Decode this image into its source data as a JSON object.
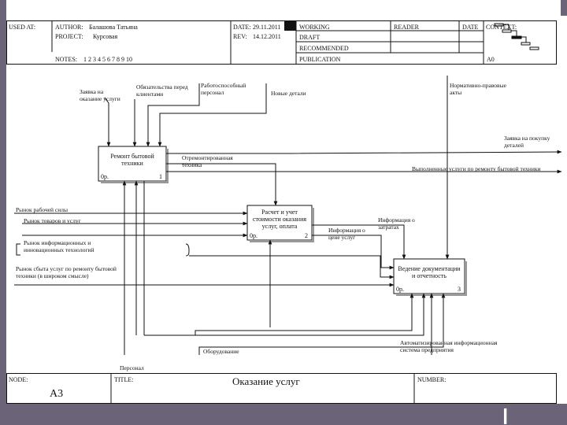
{
  "header": {
    "used_at_label": "USED AT:",
    "author_label": "AUTHOR:",
    "author_value": "Балашова Татьяна",
    "project_label": "PROJECT:",
    "project_value": "Курсовая",
    "date_label": "DATE:",
    "date_value": "29.11.2011",
    "rev_label": "REV:",
    "rev_value": "14.12.2011",
    "notes_label": "NOTES:",
    "notes_value": "1 2 3 4 5 6 7 8 9 10",
    "status_working": "WORKING",
    "status_draft": "DRAFT",
    "status_recommended": "RECOMMENDED",
    "status_publication": "PUBLICATION",
    "reader_label": "READER",
    "date2_label": "DATE",
    "context_label": "CONTEXT:",
    "context_node": "A0"
  },
  "boxes": [
    {
      "title": "Ремонт бытовой техники",
      "cost": "0р.",
      "number": "1"
    },
    {
      "title": "Расчет и учет стоимости оказания услуг, оплата",
      "cost": "0р.",
      "number": "2"
    },
    {
      "title": "Ведение документации и отчетность",
      "cost": "0р.",
      "number": "3"
    }
  ],
  "labels": {
    "order_service": "Заявка на оказание услуги",
    "obligations": "Обязательства перед клиентами",
    "working_staff": "Работоспособный персонал",
    "new_parts": "Новые детали",
    "regulations": "Нормативно-правовые акты",
    "order_parts": "Заявка на покупку деталей",
    "repaired_tech": "Отремонтированная техника",
    "services_done": "Выполненные услуги по ремонту бытовой техники",
    "labor_market": "Рынок рабочей силы",
    "goods_market": "Рынок товаров и услуг",
    "info_market": "Рынок информационных и инновационных технологий",
    "sales_market": "Рынок сбыта услуг по ремонту бытовой техники (в широком смысле)",
    "cost_info": "Информация о затратах",
    "price_info": "Информация о цене услуг",
    "personnel": "Персонал",
    "equipment": "Оборудование",
    "auto_system": "Автоматизированная информационная система предприятия"
  },
  "footer": {
    "node_label": "NODE:",
    "node_value": "A3",
    "title_label": "TITLE:",
    "title_value": "Оказание услуг",
    "number_label": "NUMBER:"
  }
}
